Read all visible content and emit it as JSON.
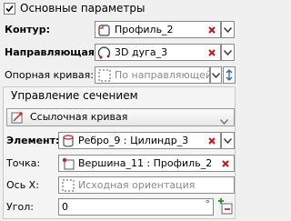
{
  "header": {
    "title": "Основные параметры",
    "checked": true
  },
  "contour": {
    "label": "Контур:",
    "value": "Профиль_2"
  },
  "guide": {
    "label": "Направляющая:",
    "value": "3D дуга_3"
  },
  "support": {
    "label": "Опорная кривая:",
    "placeholder": "По направляющей"
  },
  "section": {
    "title": "Управление сечением",
    "mode": "Ссылочная кривая",
    "element": {
      "label": "Элемент:",
      "value": "Ребро_9 : Цилиндр_3"
    },
    "point": {
      "label": "Точка:",
      "value": "Вершина_11 : Профиль_2"
    },
    "axis_x": {
      "label": "Ось X:",
      "placeholder": "Исходная ориентация"
    },
    "angle": {
      "label": "Угол:",
      "value": "0",
      "unit": "°"
    }
  },
  "colors": {
    "delete": "#c0141e",
    "accent": "#1f5fbf",
    "add": "#2e9a2e"
  },
  "icons": [
    "profile-icon",
    "arc-3d-icon",
    "dashed-curve-icon",
    "reference-curve-icon",
    "cylinder-icon",
    "vertex-icon",
    "delete-icon",
    "dropdown-arrow-icon",
    "swap-direction-icon",
    "add-icon"
  ]
}
